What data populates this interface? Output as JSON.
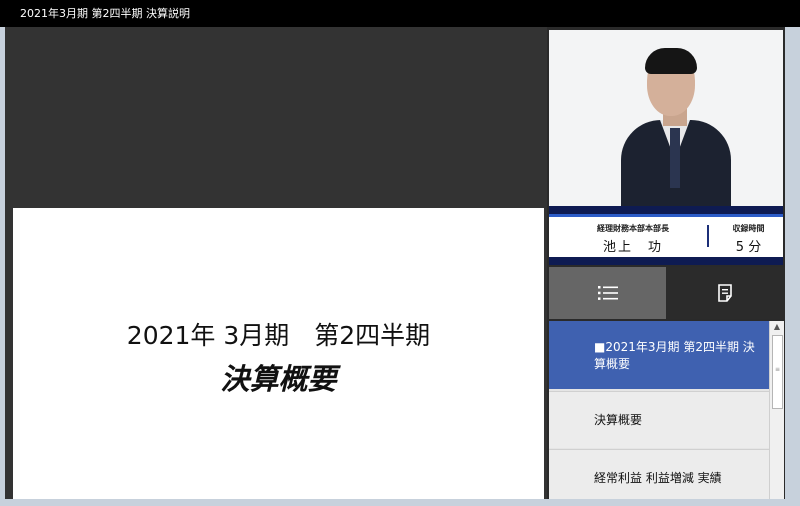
{
  "window": {
    "title": "2021年3月期 第2四半期 決算説明"
  },
  "slide": {
    "line1": "2021年 3月期　第2四半期",
    "line2": "決算概要"
  },
  "speaker": {
    "role_label": "経理財務本部本部長",
    "name": "池上　功",
    "time_label": "収録時間",
    "time_value": "5 分"
  },
  "tabs": [
    {
      "icon": "list-icon"
    },
    {
      "icon": "document-icon"
    }
  ],
  "chapters": [
    {
      "label": "■2021年3月期 第2四半期 決算概要",
      "selected": true
    },
    {
      "label": "決算概要",
      "selected": false
    },
    {
      "label": "経常利益 利益増減 実績",
      "selected": false
    }
  ],
  "colors": {
    "selected_item": "#3f61b0",
    "name_bar": "#0e1b52",
    "accent_line": "#2c5cc8"
  }
}
